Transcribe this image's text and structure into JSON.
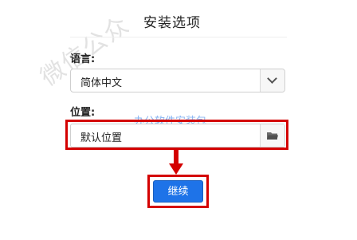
{
  "dialog": {
    "title": "安装选项"
  },
  "watermarks": {
    "main": "微信公众",
    "center": "办公软件安装包"
  },
  "language": {
    "label": "语言:",
    "selected": "简体中文"
  },
  "location": {
    "label": "位置:",
    "value": "默认位置"
  },
  "actions": {
    "continue_label": "继续"
  },
  "colors": {
    "primary_button": "#1e73e8",
    "highlight_annotation": "#d40000",
    "watermark_blue": "#468ceb"
  },
  "icons": {
    "language_dropdown": "chevron-down-icon",
    "location_browse": "folder-icon"
  }
}
